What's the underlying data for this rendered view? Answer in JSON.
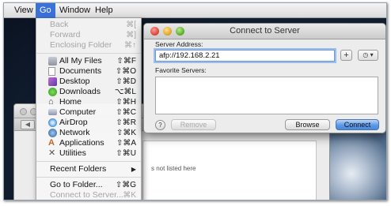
{
  "menubar": {
    "items": [
      {
        "label": "View"
      },
      {
        "label": "Go"
      },
      {
        "label": "Window"
      },
      {
        "label": "Help"
      }
    ]
  },
  "go_menu": {
    "items": [
      {
        "label": "Back",
        "shortcut": "⌘[",
        "enabled": false,
        "icon": null
      },
      {
        "label": "Forward",
        "shortcut": "⌘]",
        "enabled": false,
        "icon": null
      },
      {
        "label": "Enclosing Folder",
        "shortcut": "⌘↑",
        "enabled": false,
        "icon": null
      },
      {
        "label": "All My Files",
        "shortcut": "⇧⌘F",
        "enabled": true,
        "icon": "all-my-files-icon"
      },
      {
        "label": "Documents",
        "shortcut": "⇧⌘O",
        "enabled": true,
        "icon": "documents-icon"
      },
      {
        "label": "Desktop",
        "shortcut": "⇧⌘D",
        "enabled": true,
        "icon": "desktop-icon"
      },
      {
        "label": "Downloads",
        "shortcut": "⌥⌘L",
        "enabled": true,
        "icon": "downloads-icon"
      },
      {
        "label": "Home",
        "shortcut": "⇧⌘H",
        "enabled": true,
        "icon": "home-icon"
      },
      {
        "label": "Computer",
        "shortcut": "⇧⌘C",
        "enabled": true,
        "icon": "computer-icon"
      },
      {
        "label": "AirDrop",
        "shortcut": "⇧⌘R",
        "enabled": true,
        "icon": "airdrop-icon"
      },
      {
        "label": "Network",
        "shortcut": "⇧⌘K",
        "enabled": true,
        "icon": "network-icon"
      },
      {
        "label": "Applications",
        "shortcut": "⇧⌘A",
        "enabled": true,
        "icon": "applications-icon"
      },
      {
        "label": "Utilities",
        "shortcut": "⇧⌘U",
        "enabled": true,
        "icon": "utilities-icon"
      },
      {
        "label": "Recent Folders",
        "shortcut": "",
        "enabled": true,
        "icon": null
      },
      {
        "label": "Go to Folder...",
        "shortcut": "⇧⌘G",
        "enabled": true,
        "icon": null
      },
      {
        "label": "Connect to Server...",
        "shortcut": "⌘K",
        "enabled": false,
        "icon": null
      }
    ]
  },
  "dialog": {
    "title": "Connect to Server",
    "server_address_label": "Server Address:",
    "server_address_value": "afp://192.168.2.21",
    "plus_label": "+",
    "recent_label": "◷ ▾",
    "favorite_servers_label": "Favorite Servers:",
    "help_label": "?",
    "remove_label": "Remove",
    "browse_label": "Browse",
    "connect_label": "Connect"
  },
  "background_window": {
    "hint_text": "s not listed here"
  },
  "colors": {
    "menu_highlight": "#3b72d9",
    "connect_button": "#5c98e6",
    "disabled_text": "#a5a5a5"
  }
}
